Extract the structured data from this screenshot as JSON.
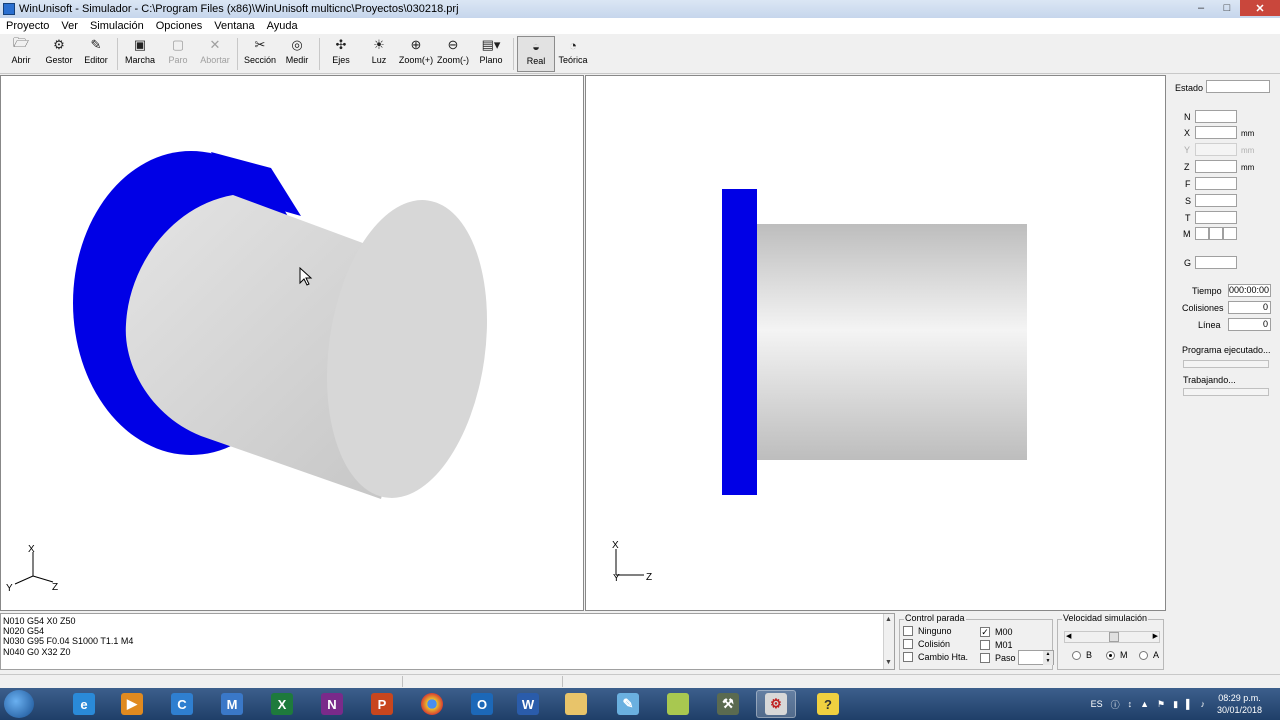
{
  "window": {
    "title": "WinUnisoft - Simulador - C:\\Program Files (x86)\\WinUnisoft multicnc\\Proyectos\\030218.prj",
    "min": "–",
    "max": "□",
    "close": "✕"
  },
  "menu": [
    "Proyecto",
    "Ver",
    "Simulación",
    "Opciones",
    "Ventana",
    "Ayuda"
  ],
  "toolbar": {
    "abrir": "Abrir",
    "gestor": "Gestor",
    "editor": "Editor",
    "marcha": "Marcha",
    "paro": "Paro",
    "abortar": "Abortar",
    "seccion": "Sección",
    "medir": "Medir",
    "ejes": "Ejes",
    "luz": "Luz",
    "zoom_in": "Zoom(+)",
    "zoom_out": "Zoom(-)",
    "plano": "Plano",
    "real": "Real",
    "teorica": "Teórica"
  },
  "axes_3d": {
    "x": "X",
    "y": "Y",
    "z": "Z"
  },
  "axes_2d": {
    "x": "X",
    "y": "Y",
    "z": "Z"
  },
  "colors": {
    "flange": "#0000e6",
    "part": "#cfcfcf"
  },
  "status": {
    "estado_label": "Estado",
    "estado_value": "",
    "n_label": "N",
    "x_label": "X",
    "y_label": "Y",
    "z_label": "Z",
    "f_label": "F",
    "s_label": "S",
    "t_label": "T",
    "m_label": "M",
    "g_label": "G",
    "unit_mm": "mm",
    "tiempo_label": "Tiempo",
    "tiempo_value": "000:00:00",
    "colisiones_label": "Colisiones",
    "colisiones_value": "0",
    "linea_label": "Línea",
    "linea_value": "0",
    "programa_label": "Programa ejecutado...",
    "trabajando_label": "Trabajando..."
  },
  "code_lines": [
    "N010 G54 X0 Z50",
    "N020 G54",
    "N030 G95 F0.04 S1000 T1.1 M4",
    "N040 G0 X32 Z0"
  ],
  "control_parada": {
    "title": "Control parada",
    "ninguno": "Ninguno",
    "colision": "Colisión",
    "cambio_hta": "Cambio Hta.",
    "m00": "M00",
    "m01": "M01",
    "paso": "Paso",
    "m00_checked": true
  },
  "velocidad": {
    "title": "Velocidad simulación",
    "b": "B",
    "m": "M",
    "a": "A",
    "selected": "M"
  },
  "taskbar": {
    "lang": "ES",
    "time": "08:29 p.m.",
    "date": "30/01/2018"
  }
}
